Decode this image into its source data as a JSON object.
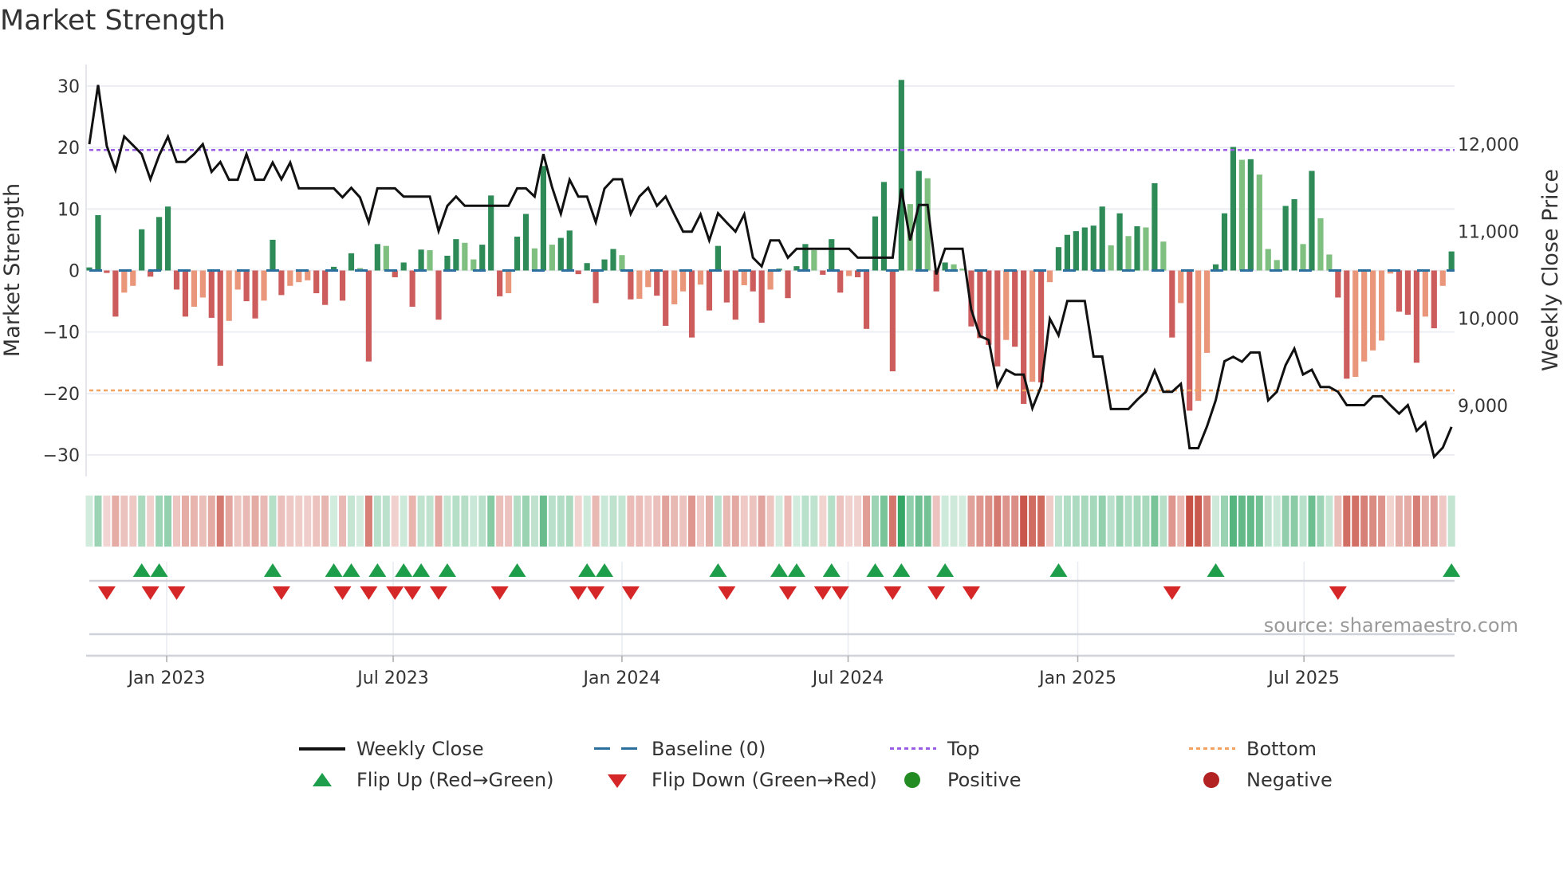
{
  "title": "Market Strength",
  "source": "source: sharemaestro.com",
  "legend": {
    "weekly_close": "Weekly Close",
    "baseline": "Baseline (0)",
    "top": "Top",
    "bottom": "Bottom",
    "flip_up": "Flip Up (Red→Green)",
    "flip_down": "Flip Down (Green→Red)",
    "positive": "Positive",
    "negative": "Negative"
  },
  "colors": {
    "strong_pos": "#2e8b57",
    "weak_pos": "#7fbf7f",
    "strong_neg": "#cd5c5c",
    "weak_neg": "#e9967a",
    "line": "#111111",
    "baseline": "#2b6f9f",
    "top": "#9b5de5",
    "bottom": "#f4a261",
    "flip_up": "#1e9e4a",
    "flip_down": "#d62728",
    "positive": "#228b22",
    "negative": "#b22222"
  },
  "chart_data": {
    "type": "bar+line",
    "title": "Market Strength",
    "ylabel": "Market Strength",
    "y2label": "Weekly Close Price",
    "ylim": [
      -33.5,
      33.5
    ],
    "y2lim": [
      8186,
      12915
    ],
    "yticks": [
      -30,
      -20,
      -10,
      0,
      10,
      20,
      30
    ],
    "ytick_labels": [
      "−30",
      "−20",
      "−10",
      "0",
      "10",
      "20",
      "30"
    ],
    "y2ticks": [
      9000,
      10000,
      11000,
      12000
    ],
    "y2tick_labels": [
      "9,000",
      "10,000",
      "11,000",
      "12,000"
    ],
    "top_level": 19.6,
    "bottom_level": -19.5,
    "baseline": 0,
    "x_week_count": 157,
    "xticks": [
      {
        "label": "Jan 2023",
        "week": 8.86
      },
      {
        "label": "Jul 2023",
        "week": 34.8
      },
      {
        "label": "Jan 2024",
        "week": 61.0
      },
      {
        "label": "Jul 2024",
        "week": 86.9
      },
      {
        "label": "Jan 2025",
        "week": 113.2
      },
      {
        "label": "Jul 2025",
        "week": 139.1
      }
    ],
    "strength": [
      0.5,
      9.0,
      -0.4,
      -7.5,
      -3.6,
      -2.5,
      6.7,
      -1.0,
      8.7,
      10.4,
      -3.1,
      -7.5,
      -5.9,
      -4.4,
      -7.7,
      -15.5,
      -8.2,
      -3.1,
      -5.0,
      -7.8,
      -4.9,
      5.0,
      -4.0,
      -2.5,
      -1.9,
      -1.6,
      -3.7,
      -5.6,
      0.6,
      -4.9,
      2.8,
      0.4,
      -14.8,
      4.3,
      4.0,
      -1.1,
      1.3,
      -5.9,
      3.4,
      3.3,
      -8.0,
      2.4,
      5.1,
      4.5,
      1.8,
      4.2,
      12.2,
      -4.2,
      -3.7,
      5.5,
      9.2,
      3.6,
      17.0,
      4.2,
      5.3,
      6.5,
      -0.6,
      1.2,
      -5.3,
      1.8,
      3.5,
      2.5,
      -4.7,
      -4.6,
      -2.7,
      -4.1,
      -9.0,
      -5.5,
      -3.4,
      -10.9,
      -2.3,
      -6.5,
      4.0,
      -5.2,
      -8.0,
      -2.4,
      -3.4,
      -8.5,
      -3.1,
      0.3,
      -4.5,
      0.7,
      4.3,
      3.3,
      -0.7,
      5.1,
      -3.6,
      -0.9,
      -1.1,
      -9.5,
      8.8,
      14.4,
      -16.4,
      31.0,
      10.8,
      16.2,
      15.0,
      -3.4,
      1.3,
      1.0,
      0.3,
      -9.1,
      -11.0,
      -12.1,
      -15.6,
      -11.3,
      -12.4,
      -21.7,
      -18.1,
      -18.2,
      -1.9,
      3.8,
      5.8,
      6.4,
      7.0,
      7.3,
      10.4,
      4.1,
      9.3,
      5.6,
      7.2,
      7.0,
      14.2,
      4.7,
      -10.9,
      -5.3,
      -22.8,
      -21.2,
      -13.4,
      1.0,
      9.3,
      20.1,
      18.0,
      18.1,
      15.6,
      3.5,
      1.7,
      10.5,
      11.6,
      4.3,
      16.2,
      8.5,
      2.6,
      -4.4,
      -17.6,
      -17.3,
      -14.8,
      -13.0,
      -11.4,
      -0.5,
      -6.7,
      -7.2,
      -15.0,
      -7.5,
      -9.4,
      -2.5,
      3.1
    ],
    "weekly_close": [
      12000,
      12680,
      11979,
      11704,
      12089,
      11988,
      11887,
      11598,
      11872,
      12086,
      11796,
      11796,
      11887,
      12000,
      11683,
      11796,
      11592,
      11592,
      11887,
      11592,
      11592,
      11790,
      11598,
      11790,
      11494,
      11494,
      11494,
      11494,
      11494,
      11390,
      11500,
      11390,
      11104,
      11494,
      11494,
      11494,
      11399,
      11399,
      11399,
      11399,
      11003,
      11293,
      11399,
      11293,
      11293,
      11293,
      11293,
      11293,
      11293,
      11494,
      11494,
      11399,
      11887,
      11506,
      11201,
      11592,
      11399,
      11399,
      11104,
      11491,
      11598,
      11598,
      11201,
      11399,
      11500,
      11293,
      11399,
      11195,
      10997,
      10997,
      11195,
      10896,
      11207,
      11100,
      10997,
      11195,
      10698,
      10597,
      10896,
      10896,
      10698,
      10799,
      10799,
      10799,
      10799,
      10799,
      10799,
      10799,
      10698,
      10698,
      10698,
      10698,
      10698,
      11491,
      10896,
      11302,
      11302,
      10506,
      10799,
      10799,
      10799,
      10103,
      9798,
      9752,
      9219,
      9411,
      9356,
      9356,
      8969,
      9219,
      9997,
      9807,
      10201,
      10201,
      10201,
      9563,
      9563,
      8960,
      8960,
      8960,
      9066,
      9158,
      9402,
      9158,
      9158,
      9249,
      8511,
      8511,
      8761,
      9060,
      9509,
      9560,
      9503,
      9609,
      9609,
      9060,
      9158,
      9463,
      9652,
      9356,
      9411,
      9213,
      9213,
      9158,
      9005,
      9005,
      9005,
      9106,
      9106,
      9005,
      8908,
      9005,
      8710,
      8807,
      8411,
      8517,
      8755
    ]
  }
}
